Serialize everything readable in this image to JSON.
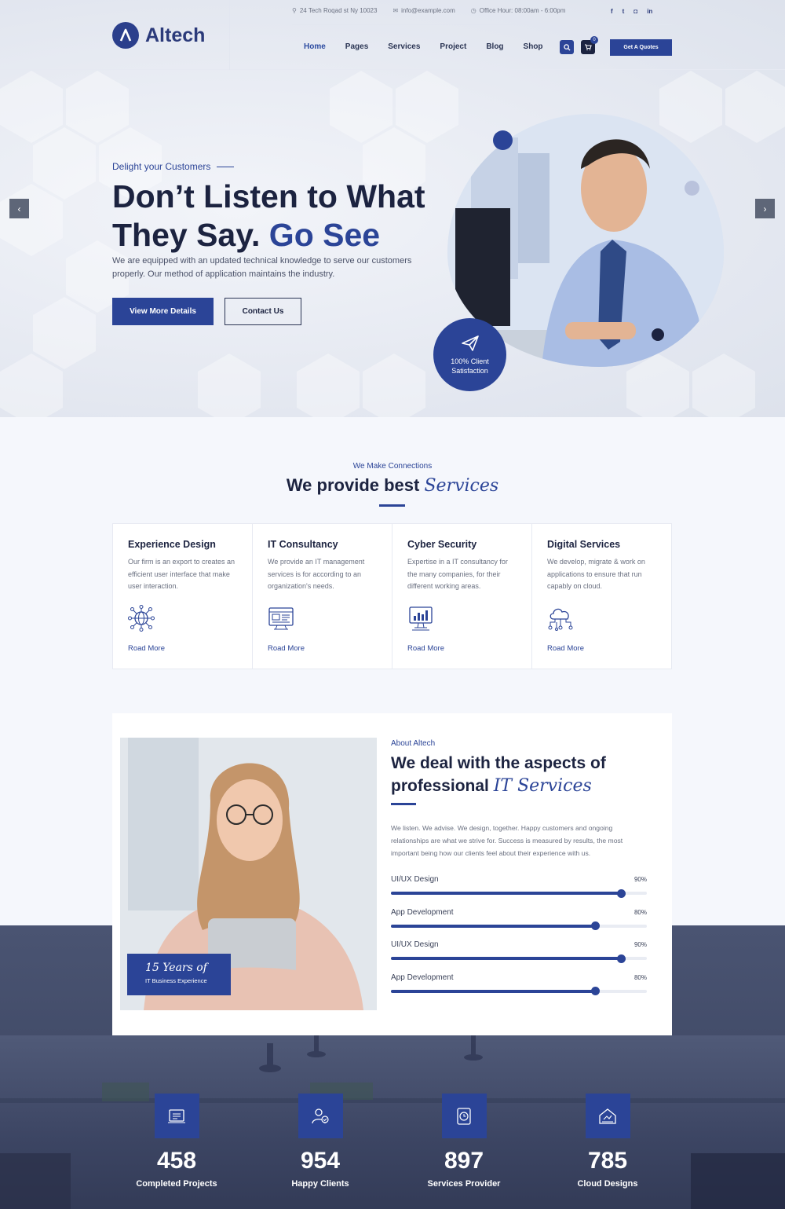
{
  "header": {
    "brand": "Altech",
    "address": "24 Tech Roqad st Ny 10023",
    "email": "info@example.com",
    "office_hours": "Office Hour: 08:00am - 6:00pm",
    "socials": [
      "f",
      "t",
      "in"
    ],
    "nav": [
      "Home",
      "Pages",
      "Services",
      "Project",
      "Blog",
      "Shop"
    ],
    "cart_count": "0",
    "quote_button": "Get A Quotes"
  },
  "hero": {
    "eyebrow": "Delight your Customers",
    "title_line1": "Don’t Listen to What",
    "title_line2": "They Say.",
    "title_accent": "Go See",
    "description": "We are equipped with an updated technical knowledge to serve our customers properly. Our method of application maintains the industry.",
    "primary_button": "View More Details",
    "secondary_button": "Contact Us",
    "badge_line1": "100% Client",
    "badge_line2": "Satisfaction",
    "prev_label": "‹",
    "next_label": "›"
  },
  "services": {
    "eyebrow": "We Make Connections",
    "title": "We provide best",
    "title_accent": "Services",
    "items": [
      {
        "title": "Experience Design",
        "text": "Our firm is an export to creates an efficient user interface that make user interaction.",
        "link": "Road More",
        "icon": "network-globe-icon"
      },
      {
        "title": "IT Consultancy",
        "text": "We provide an IT management services is for according to an organization's needs.",
        "link": "Road More",
        "icon": "browser-window-icon"
      },
      {
        "title": "Cyber Security",
        "text": "Expertise in a IT consultancy for the many companies, for their different working areas.",
        "link": "Road More",
        "icon": "monitor-chart-icon"
      },
      {
        "title": "Digital Services",
        "text": "We develop, migrate & work on applications to ensure that run capably on cloud.",
        "link": "Road More",
        "icon": "cloud-network-icon"
      }
    ]
  },
  "about": {
    "eyebrow": "About Altech",
    "title": "We deal with the aspects of professional",
    "title_accent": "IT Services",
    "description": "We listen. We advise. We design, together. Happy customers and ongoing relationships are what we strive for. Success is measured by results, the most important being how our clients feel about their experience with us.",
    "years_big": "15 Years of",
    "years_small": "IT Business Experience",
    "skills": [
      {
        "label": "UI/UX Design",
        "percent": 90,
        "display": "90%"
      },
      {
        "label": "App Development",
        "percent": 80,
        "display": "80%"
      },
      {
        "label": "UI/UX Design",
        "percent": 90,
        "display": "90%"
      },
      {
        "label": "App Development",
        "percent": 80,
        "display": "80%"
      }
    ]
  },
  "stats": [
    {
      "number": "458",
      "label": "Completed Projects",
      "icon": "projects-icon"
    },
    {
      "number": "954",
      "label": "Happy Clients",
      "icon": "clients-icon"
    },
    {
      "number": "897",
      "label": "Services Provider",
      "icon": "services-icon"
    },
    {
      "number": "785",
      "label": "Cloud Designs",
      "icon": "cloud-design-icon"
    }
  ],
  "colors": {
    "primary": "#2b4497",
    "dark": "#1c2340"
  }
}
